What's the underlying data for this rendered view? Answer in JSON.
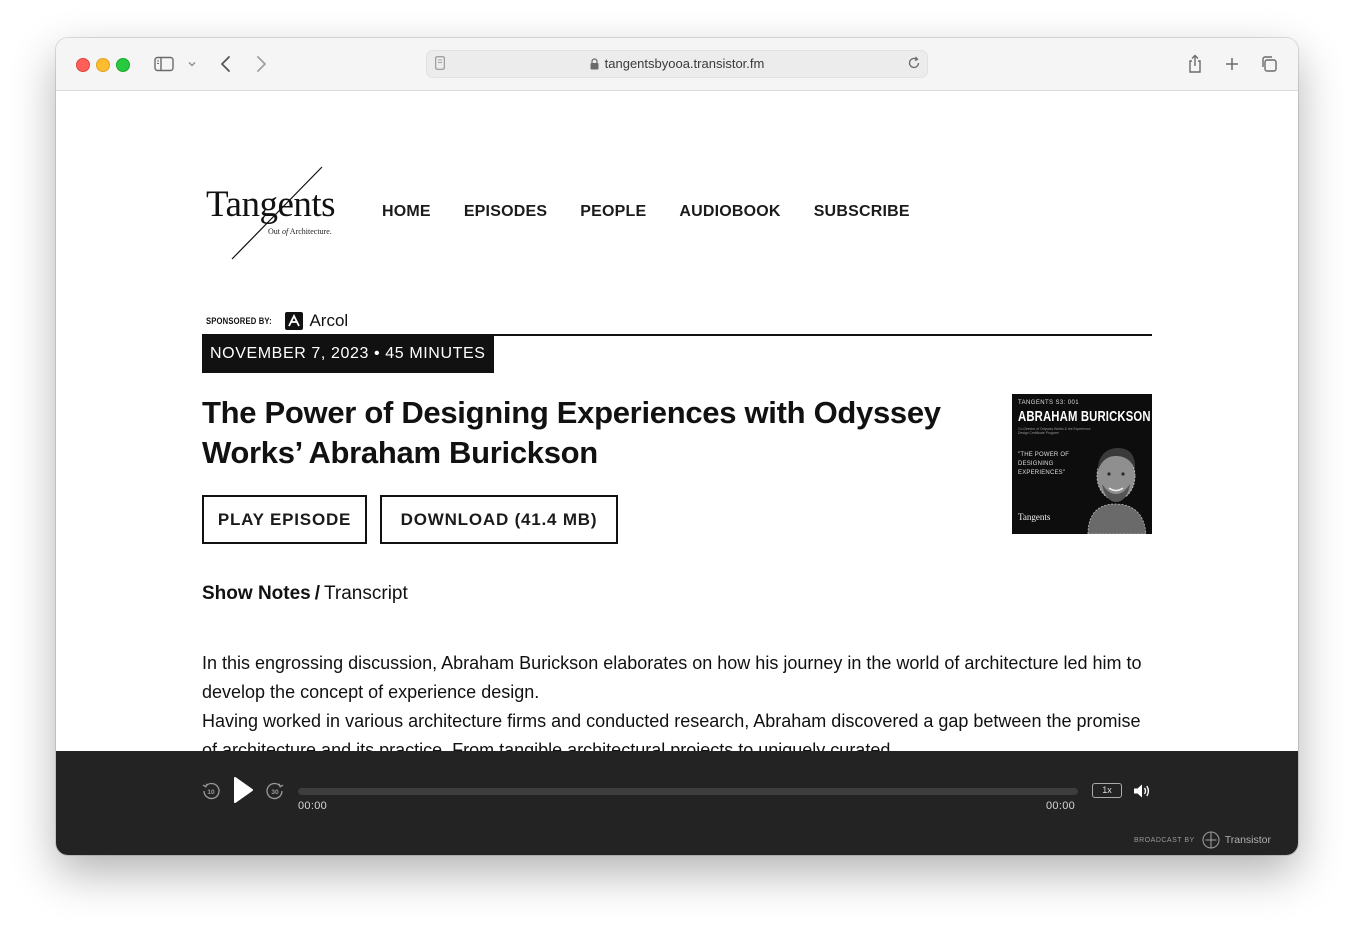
{
  "browser": {
    "url": "tangentsbyooa.transistor.fm"
  },
  "site": {
    "logo_word": "Tangents",
    "logo_sub_before": "Out ",
    "logo_sub_of": "of",
    "logo_sub_after": " Architecture.",
    "sponsor_label": "SPONSORED BY:",
    "sponsor_name": "Arcol"
  },
  "nav": {
    "items": [
      {
        "label": "HOME"
      },
      {
        "label": "EPISODES"
      },
      {
        "label": "PEOPLE"
      },
      {
        "label": "AUDIOBOOK"
      },
      {
        "label": "SUBSCRIBE"
      }
    ]
  },
  "episode": {
    "meta": "NOVEMBER 7, 2023 • 45 MINUTES",
    "title": "The Power of Designing Experiences with Odyssey Works’ Abraham Burickson",
    "play_label": "PLAY EPISODE",
    "download_label": "DOWNLOAD (41.4 MB)",
    "cover": {
      "series": "TANGENTS S3: 001",
      "name": "ABRAHAM BURICKSON",
      "role": "Co-Director of Odyssey Works & the Experience Design Certificate Program",
      "quote": "\"THE POWER OF DESIGNING EXPERIENCES\"",
      "logo": "Tangents"
    }
  },
  "tabs": {
    "show_notes": "Show Notes",
    "separator": "/",
    "transcript": "Transcript"
  },
  "notes": {
    "p1": "In this engrossing discussion, Abraham Burickson elaborates on how his journey in the world of architecture led him to develop the concept of experience design.",
    "p2": "Having worked in various architecture firms and conducted research, Abraham discovered a gap between the promise of architecture and its practice. From tangible architectural projects to uniquely curated"
  },
  "player": {
    "elapsed": "00:00",
    "duration": "00:00",
    "progress_fraction": 0,
    "speed": "1x",
    "skip_back": "10",
    "skip_forward": "30",
    "broadcast_label": "BROADCAST BY",
    "broadcast_name": "Transistor"
  }
}
